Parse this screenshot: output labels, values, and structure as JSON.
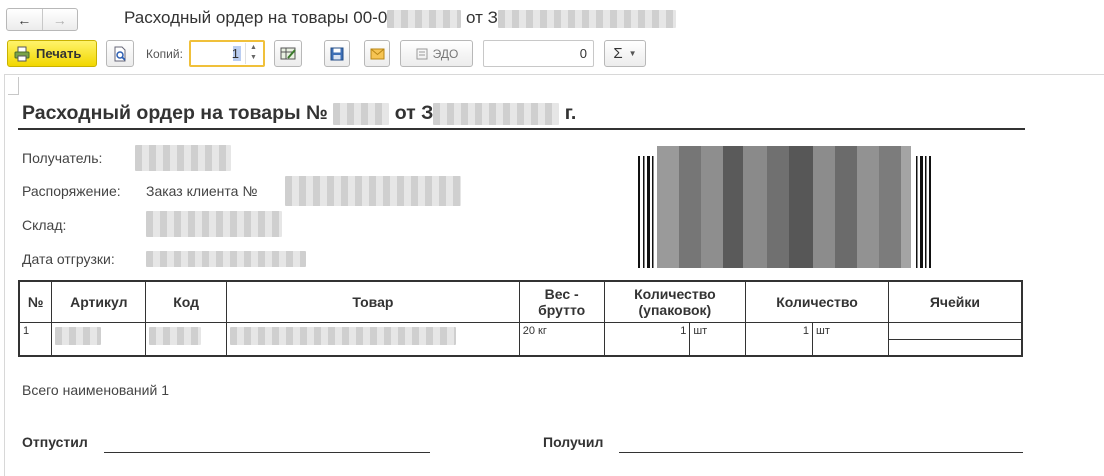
{
  "window": {
    "title_prefix": "Расходный ордер на товары 00-0",
    "title_mid": "от З"
  },
  "toolbar": {
    "print_label": "Печать",
    "copies_label": "Копий:",
    "copies_value": "1",
    "edo_label": "ЭДО",
    "number_value": "0",
    "sum_symbol": "Σ"
  },
  "document": {
    "title_prefix": "Расходный ордер на товары №",
    "title_mid": "от З",
    "title_suffix": "г.",
    "recipient_label": "Получатель:",
    "order_label": "Распоряжение:",
    "order_value": "Заказ клиента №",
    "warehouse_label": "Склад:",
    "ship_date_label": "Дата отгрузки:"
  },
  "table": {
    "headers": {
      "num": "№",
      "article": "Артикул",
      "code": "Код",
      "product": "Товар",
      "weight_line1": "Вес -",
      "weight_line2": "брутто",
      "qty_pack_line1": "Количество",
      "qty_pack_line2": "(упаковок)",
      "qty": "Количество",
      "cells": "Ячейки"
    },
    "rows": [
      {
        "num": "1",
        "weight": "20 кг",
        "qty_pack": "1",
        "qty_pack_unit": "шт",
        "qty": "1",
        "qty_unit": "шт"
      }
    ]
  },
  "footer": {
    "total": "Всего наименований 1",
    "released_label": "Отпустил",
    "received_label": "Получил"
  }
}
